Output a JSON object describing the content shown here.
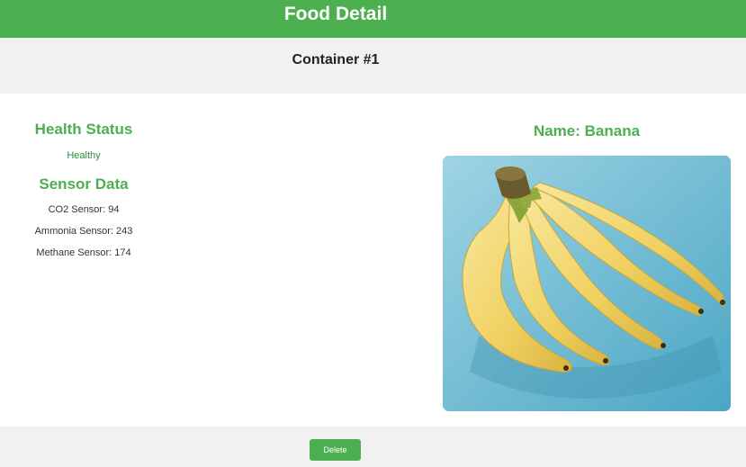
{
  "header": {
    "title": "Food Detail"
  },
  "container": {
    "title": "Container #1"
  },
  "health": {
    "heading": "Health Status",
    "status": "Healthy"
  },
  "sensors": {
    "heading": "Sensor Data",
    "items": [
      {
        "label": "CO2 Sensor: 94"
      },
      {
        "label": "Ammonia Sensor: 243"
      },
      {
        "label": "Methane Sensor: 174"
      }
    ]
  },
  "food": {
    "name_label": "Name: Banana"
  },
  "footer": {
    "delete_label": "Delete"
  },
  "colors": {
    "accent": "#4caf50",
    "panel": "#f1f1f1",
    "photo_background": "#7fc3d8"
  }
}
